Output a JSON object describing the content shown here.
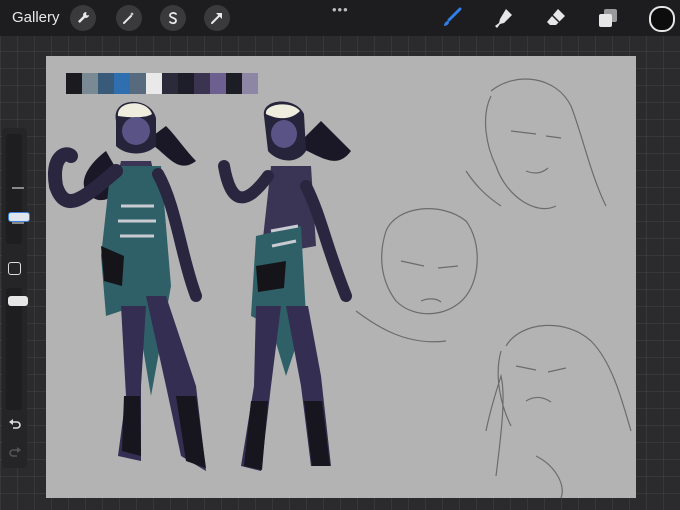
{
  "toolbar": {
    "gallery_label": "Gallery",
    "left_tools": [
      "wrench-icon",
      "magic-wand-icon",
      "selection-icon",
      "transform-arrow-icon"
    ],
    "right_tools": [
      "brush-icon",
      "smudge-icon",
      "eraser-icon",
      "layers-icon"
    ],
    "more_dots": "•••",
    "active_tool_color": "#2f7fe6",
    "current_color": "#0d0d0d"
  },
  "sidebar": {
    "brush_size_level": 0.72,
    "opacity_level": 0.62,
    "icons": [
      "modify-square-icon",
      "undo-icon",
      "redo-icon"
    ]
  },
  "canvas": {
    "background": "#b3b3b3",
    "palette": [
      "#1b1b1f",
      "#7a8a94",
      "#3a5a7a",
      "#2f6fb0",
      "#586a7e",
      "#e9e9e9",
      "#2a2a3a",
      "#1e1e2a",
      "#3a3450",
      "#6d5f8f",
      "#1d1d25",
      "#8d86a5"
    ]
  }
}
